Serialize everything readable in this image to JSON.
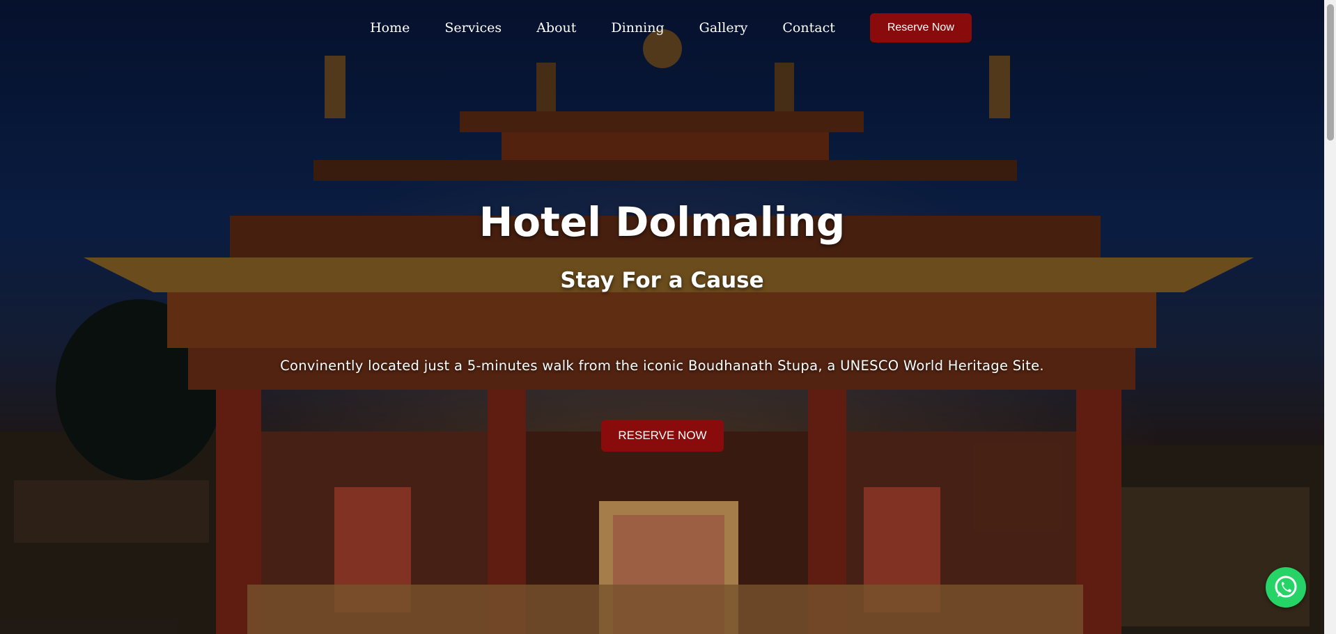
{
  "nav": {
    "items": [
      "Home",
      "Services",
      "About",
      "Dinning",
      "Gallery",
      "Contact"
    ],
    "reserve_label": "Reserve Now"
  },
  "hero": {
    "title": "Hotel Dolmaling",
    "subtitle": "Stay For a Cause",
    "description": "Convinently located just a 5-minutes walk from the iconic Boudhanath Stupa, a UNESCO World Heritage Site.",
    "cta_label": "RESERVE NOW",
    "background_description": "Illuminated Tibetan Buddhist monastery gateway at dusk with ornate red and gold pagoda roof",
    "cta_color": "#8a0b0b"
  },
  "floating": {
    "whatsapp_icon": "whatsapp-icon"
  }
}
